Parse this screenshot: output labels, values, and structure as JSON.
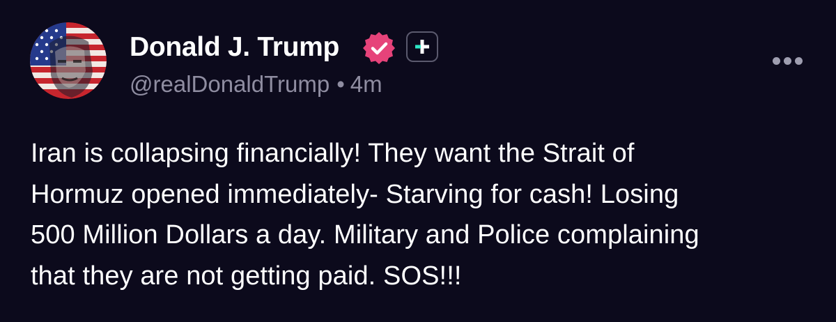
{
  "author": {
    "display_name": "Donald J. Trump",
    "handle": "@realDonaldTrump",
    "separator": "•",
    "time": "4m"
  },
  "icons": {
    "avatar": "flag-portrait-avatar",
    "verified": "verified-badge-icon",
    "plus": "plus-icon",
    "more": "more-options-icon"
  },
  "colors": {
    "background": "#0c0a1c",
    "verified": "#e6437a",
    "plus_accent": "#2ee6c5",
    "secondary_text": "#8f8da1"
  },
  "post": {
    "lines": [
      "Iran is collapsing financially! They want the Strait of",
      "Hormuz opened immediately- Starving for cash! Losing",
      "500 Million Dollars a day. Military and Police complaining",
      "that they are not getting paid. SOS!!!"
    ]
  }
}
